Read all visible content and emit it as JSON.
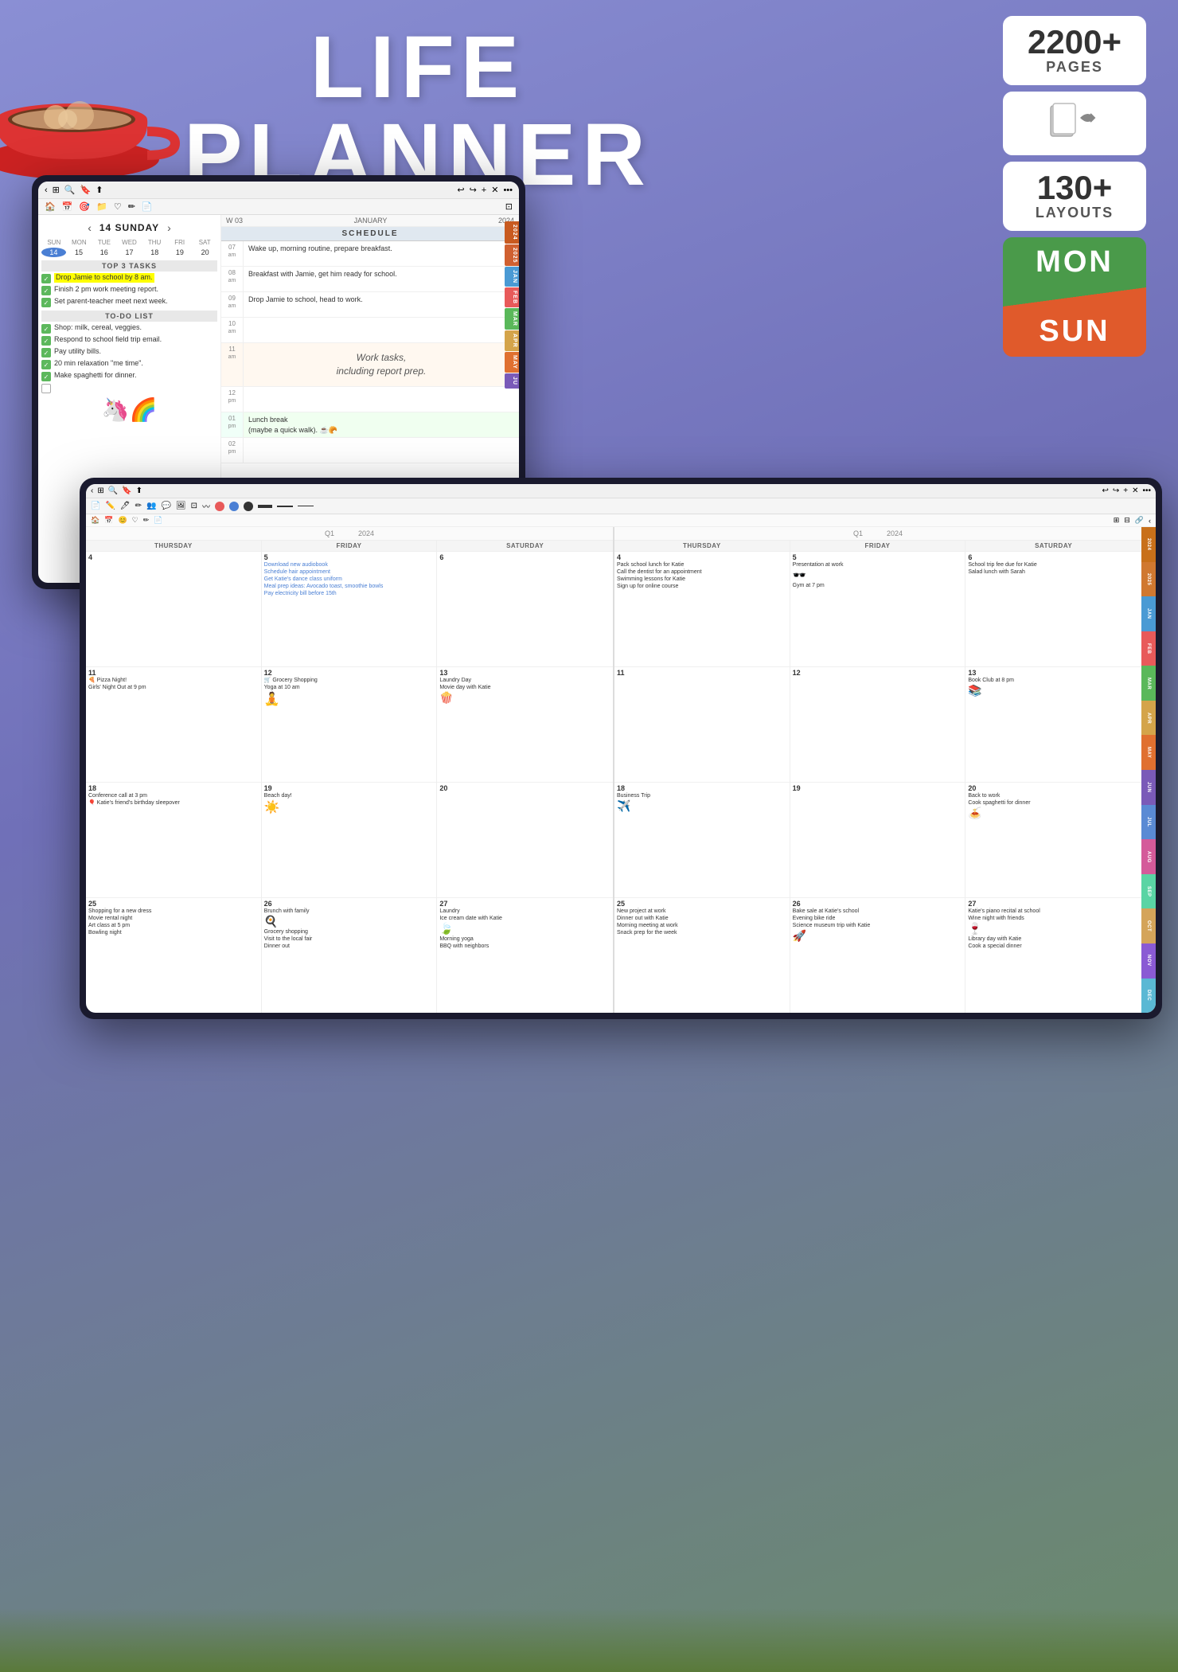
{
  "page": {
    "title": "Life Planner",
    "background_color": "#7b7fc4"
  },
  "header": {
    "title_line1": "LIFE",
    "title_line2": "PLANNER"
  },
  "badges": {
    "pages_count": "2200+",
    "pages_label": "PAGES",
    "layouts_count": "130+",
    "layouts_label": "LAYOUTS",
    "mon_label": "MON",
    "sun_label": "SUN"
  },
  "ipad1": {
    "date": "14 SUNDAY",
    "week": "W 03",
    "month": "JANUARY",
    "year": "2024",
    "mini_cal": {
      "days_header": [
        "SUN",
        "MON",
        "TUE",
        "WED",
        "THU",
        "FRI",
        "SAT"
      ],
      "days": [
        "14",
        "15",
        "16",
        "17",
        "18",
        "19",
        "20"
      ]
    },
    "top3_header": "TOP 3 TASKS",
    "tasks_top3": [
      {
        "text": "Drop Jamie to school by 8 am.",
        "done": true,
        "highlight": true
      },
      {
        "text": "Finish 2 pm work meeting report.",
        "done": true
      },
      {
        "text": "Set parent-teacher meet next week.",
        "done": true
      }
    ],
    "todo_header": "TO-DO LIST",
    "tasks_todo": [
      {
        "text": "Shop: milk, cereal, veggies.",
        "done": true
      },
      {
        "text": "Respond to school field trip email.",
        "done": true
      },
      {
        "text": "Pay utility bills.",
        "done": true
      },
      {
        "text": "20 min relaxation \"me time\".",
        "done": true
      },
      {
        "text": "Make spaghetti for dinner.",
        "done": true
      },
      {
        "text": "",
        "done": false
      },
      {
        "text": "",
        "done": false
      }
    ],
    "schedule_header": "SCHEDULE",
    "schedule": [
      {
        "time": "07",
        "unit": "am",
        "event": "Wake up, morning routine, prepare breakfast."
      },
      {
        "time": "08",
        "unit": "am",
        "event": "Breakfast with Jamie, get him ready for school."
      },
      {
        "time": "09",
        "unit": "am",
        "event": "Drop Jamie to school, head to work."
      },
      {
        "time": "10",
        "unit": "am",
        "event": ""
      },
      {
        "time": "11",
        "unit": "am",
        "event": "Work tasks, including report prep.",
        "type": "work"
      },
      {
        "time": "12",
        "unit": "pm",
        "event": ""
      },
      {
        "time": "01",
        "unit": "pm",
        "event": "Lunch break (maybe a quick walk).",
        "type": "lunch"
      },
      {
        "time": "02",
        "unit": "pm",
        "event": ""
      }
    ],
    "side_tabs": [
      "2024",
      "2025",
      "JAN",
      "FEB",
      "MAR",
      "APR",
      "MAY",
      "JU"
    ]
  },
  "ipad2": {
    "quarter": "Q1",
    "year": "2024",
    "columns": [
      {
        "header": "THURSDAY",
        "weeks": [
          {
            "day": "4",
            "events": []
          },
          {
            "day": "11",
            "events": [
              "Pizza Night!",
              "Girls' Night Out at 9 pm"
            ]
          },
          {
            "day": "18",
            "events": [
              "Conference call at 3 pm",
              "Katie's friend's birthday sleepover"
            ]
          },
          {
            "day": "25",
            "events": [
              "Shopping for a new dress",
              "Movie rental night",
              "Art class at 5 pm",
              "Bowling night"
            ]
          }
        ]
      },
      {
        "header": "FRIDAY",
        "weeks": [
          {
            "day": "5",
            "events": [
              "Download new audiobook",
              "Schedule hair appointment",
              "Get Katie's dance class uniform",
              "Meal prep ideas: Avocado toast, smoothie bowls",
              "Pay electricity bill before 15th"
            ]
          },
          {
            "day": "12",
            "events": [
              "Grocery Shopping",
              "Yoga at 10 am"
            ]
          },
          {
            "day": "19",
            "events": [
              "Beach day!"
            ]
          },
          {
            "day": "26",
            "events": [
              "Brunch with family",
              "Grocery shopping",
              "Visit to the local fair",
              "Dinner out"
            ]
          }
        ]
      },
      {
        "header": "SATURDAY",
        "weeks": [
          {
            "day": "6",
            "events": []
          },
          {
            "day": "13",
            "events": [
              "Laundry Day",
              "Movie day with Katie"
            ]
          },
          {
            "day": "20",
            "events": []
          },
          {
            "day": "27",
            "events": [
              "Laundry",
              "Ice cream date with Katie",
              "Morning yoga",
              "BBQ with neighbors"
            ]
          }
        ]
      }
    ],
    "columns2": [
      {
        "header": "THURSDAY",
        "weeks": [
          {
            "day": "4",
            "events": [
              "Pack school lunch for Katie",
              "Call the dentist for an appointment",
              "Swimming lessons for Katie",
              "Sign up for online course"
            ]
          },
          {
            "day": "11",
            "events": []
          },
          {
            "day": "18",
            "events": [
              "Business Trip"
            ]
          },
          {
            "day": "25",
            "events": [
              "New project at work",
              "Dinner out with Katie",
              "Morning meeting at work",
              "Snack prep for the week"
            ]
          }
        ]
      },
      {
        "header": "FRIDAY",
        "weeks": [
          {
            "day": "5",
            "events": [
              "Presentation at work",
              "Gym at 7 pm"
            ]
          },
          {
            "day": "12",
            "events": []
          },
          {
            "day": "19",
            "events": []
          },
          {
            "day": "26",
            "events": [
              "Bake sale at Katie's school",
              "Evening bike ride",
              "Science museum trip with Katie"
            ]
          }
        ]
      },
      {
        "header": "SATURDAY",
        "weeks": [
          {
            "day": "6",
            "events": [
              "School trip fee due for Katie",
              "Salad lunch with Sarah"
            ]
          },
          {
            "day": "13",
            "events": [
              "Book Club at 8 pm"
            ]
          },
          {
            "day": "20",
            "events": [
              "Back to work",
              "Cook spaghetti for dinner"
            ]
          },
          {
            "day": "27",
            "events": [
              "Katie's piano recital at school",
              "Wine night with friends",
              "Library day with Katie",
              "Cook a special dinner"
            ]
          }
        ]
      }
    ],
    "side_tabs": [
      {
        "label": "2024",
        "color": "#c8701a"
      },
      {
        "label": "2025",
        "color": "#d07830"
      },
      {
        "label": "JAN",
        "color": "#4a9ad4"
      },
      {
        "label": "FEB",
        "color": "#e85a5a"
      },
      {
        "label": "MAR",
        "color": "#5ab85a"
      },
      {
        "label": "APR",
        "color": "#d4a44a"
      },
      {
        "label": "MAY",
        "color": "#e07030"
      },
      {
        "label": "JUN",
        "color": "#7a5ab8"
      },
      {
        "label": "JUL",
        "color": "#5a8ad4"
      },
      {
        "label": "AUG",
        "color": "#d45a9a"
      },
      {
        "label": "SEP",
        "color": "#5ad4a4"
      },
      {
        "label": "OCT",
        "color": "#d4a45a"
      },
      {
        "label": "NOV",
        "color": "#8a5ad4"
      },
      {
        "label": "DEC",
        "color": "#5ab8d4"
      }
    ]
  }
}
